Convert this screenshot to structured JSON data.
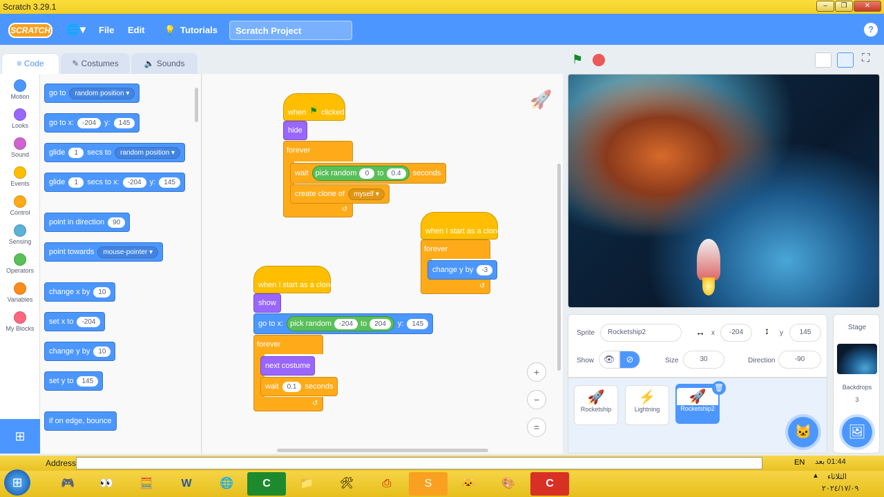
{
  "window": {
    "title": "Scratch 3.29.1",
    "controls": [
      "–",
      "❐",
      "✕"
    ]
  },
  "menubar": {
    "logo": "SCRATCH",
    "file": "File",
    "edit": "Edit",
    "tutorials": "Tutorials",
    "project_title": "Scratch Project",
    "help": "?"
  },
  "tabs": {
    "code": "Code",
    "costumes": "Costumes",
    "sounds": "Sounds"
  },
  "categories": [
    {
      "label": "Motion",
      "color": "#4c97ff"
    },
    {
      "label": "Looks",
      "color": "#9966ff"
    },
    {
      "label": "Sound",
      "color": "#cf63cf"
    },
    {
      "label": "Events",
      "color": "#ffbf00"
    },
    {
      "label": "Control",
      "color": "#ffab19"
    },
    {
      "label": "Sensing",
      "color": "#5cb1d6"
    },
    {
      "label": "Operators",
      "color": "#59c059"
    },
    {
      "label": "Variables",
      "color": "#ff8c1a"
    },
    {
      "label": "My Blocks",
      "color": "#ff6680"
    }
  ],
  "palette": {
    "goto": "go to",
    "goto_dd": "random position",
    "gotoxy": "go to x:",
    "gotoxy_x": "-204",
    "y": "y:",
    "gotoxy_y": "145",
    "glide": "glide",
    "glide1": "1",
    "secs_to": "secs to",
    "glide_dd": "random position",
    "secs_to_x": "secs to x:",
    "glide2_x": "-204",
    "glide2_y": "145",
    "point_dir": "point in direction",
    "point_dir_val": "90",
    "point_towards": "point towards",
    "point_towards_dd": "mouse-pointer",
    "change_x": "change x by",
    "change_x_val": "10",
    "set_x": "set x to",
    "set_x_val": "-204",
    "change_y": "change y by",
    "change_y_val": "10",
    "set_y": "set y to",
    "set_y_val": "145",
    "bounce": "if on edge, bounce"
  },
  "script1": {
    "when": "when",
    "clicked": "clicked",
    "hide": "hide",
    "forever": "forever",
    "wait": "wait",
    "pick_random": "pick random",
    "from": "0",
    "to": "to",
    "to_val": "0.4",
    "seconds": "seconds",
    "create_clone": "create clone of",
    "clone_dd": "myself"
  },
  "script2": {
    "hat": "when I start as a clone",
    "forever": "forever",
    "change_y": "change y by",
    "change_y_val": "-3"
  },
  "script3": {
    "hat": "when I start as a clone",
    "show": "show",
    "goto": "go to x:",
    "pick_random": "pick random",
    "from": "-204",
    "to": "to",
    "to_val": "204",
    "y": "y:",
    "y_val": "145",
    "forever": "forever",
    "next_costume": "next costume",
    "wait": "wait",
    "wait_val": "0.1",
    "seconds": "seconds"
  },
  "zoom": {
    "in": "+",
    "out": "−",
    "reset": "="
  },
  "sprite_info": {
    "sprite_label": "Sprite",
    "sprite_name": "Rocketship2",
    "x_label": "x",
    "x_val": "-204",
    "y_label": "y",
    "y_val": "145",
    "show_label": "Show",
    "size_label": "Size",
    "size_val": "30",
    "direction_label": "Direction",
    "direction_val": "-90"
  },
  "sprites": [
    {
      "name": "Rocketship",
      "icon": "rocket-icon"
    },
    {
      "name": "Lightning",
      "icon": "lightning-icon"
    },
    {
      "name": "Rocketship2",
      "icon": "rocket-icon",
      "selected": true
    }
  ],
  "stage_panel": {
    "label": "Stage",
    "backdrops_label": "Backdrops",
    "backdrops_count": "3"
  },
  "address": {
    "label": "Address"
  },
  "system_tray": {
    "lang": "EN",
    "time": "01:44 بعد",
    "day": "الثلاثاء",
    "date": "٢٠٢٤/١٧/٠٩"
  }
}
